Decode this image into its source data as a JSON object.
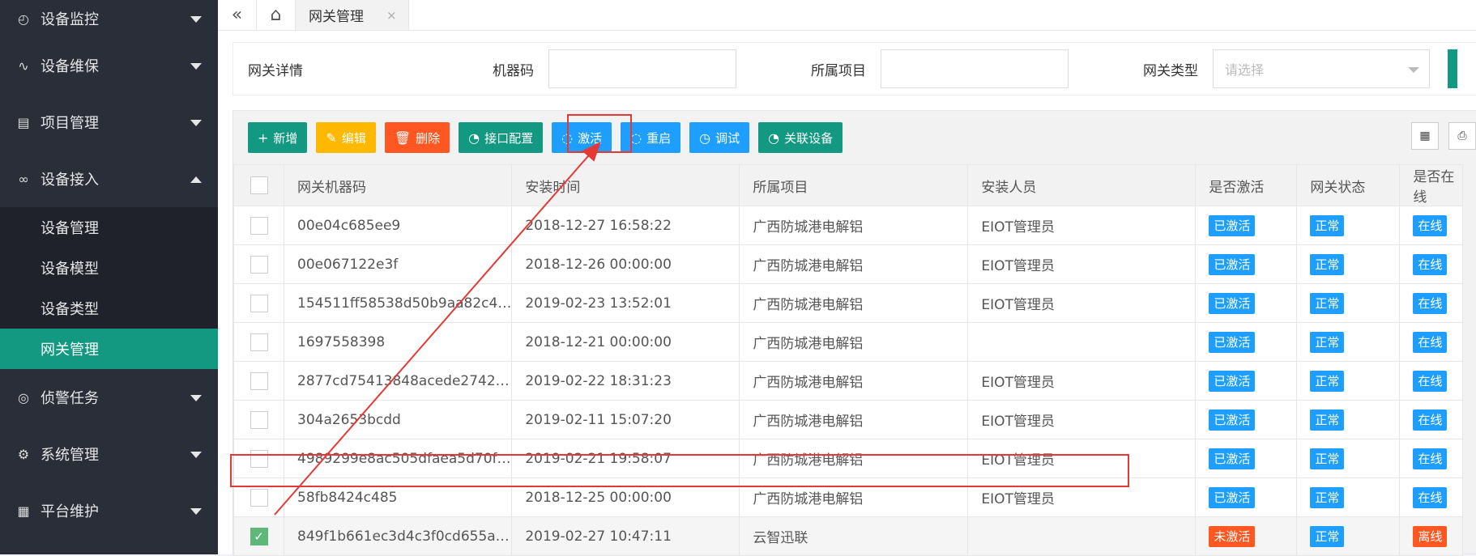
{
  "sidebar": {
    "items": [
      {
        "label": "设备监控",
        "icon": "dashboard-icon"
      },
      {
        "label": "设备维保",
        "icon": "pulse-icon"
      },
      {
        "label": "项目管理",
        "icon": "book-icon"
      },
      {
        "label": "设备接入",
        "icon": "link-icon",
        "expanded": true,
        "children": [
          {
            "label": "设备管理"
          },
          {
            "label": "设备模型"
          },
          {
            "label": "设备类型"
          },
          {
            "label": "网关管理",
            "active": true
          }
        ]
      },
      {
        "label": "侦警任务",
        "icon": "target-icon"
      },
      {
        "label": "系统管理",
        "icon": "gear-icon"
      },
      {
        "label": "平台维护",
        "icon": "grid-icon"
      }
    ]
  },
  "tabs": {
    "collapse_glyph": "«",
    "home_glyph": "⌂",
    "active_tab": "网关管理",
    "close_glyph": "×"
  },
  "filter": {
    "title": "网关详情",
    "machine_code_label": "机器码",
    "machine_code_value": "",
    "project_label": "所属项目",
    "project_value": "",
    "gateway_type_label": "网关类型",
    "gateway_type_placeholder": "请选择"
  },
  "toolbar": {
    "buttons": [
      {
        "label": "新增",
        "glyph": "+"
      },
      {
        "label": "编辑",
        "glyph": "✎"
      },
      {
        "label": "删除",
        "glyph": "🗑"
      },
      {
        "label": "接口配置",
        "glyph": "◔"
      },
      {
        "label": "激活",
        "glyph": "◌"
      },
      {
        "label": "重启",
        "glyph": "◌"
      },
      {
        "label": "调试",
        "glyph": "◷"
      },
      {
        "label": "关联设备",
        "glyph": "◔"
      }
    ],
    "right_icons": [
      "columns-icon",
      "print-icon"
    ]
  },
  "table": {
    "columns": [
      "网关机器码",
      "安装时间",
      "所属项目",
      "安装人员",
      "是否激活",
      "网关状态",
      "是否在线"
    ],
    "rows": [
      {
        "code": "00e04c685ee9",
        "time": "2018-12-27 16:58:22",
        "project": "广西防城港电解铝",
        "installer": "EIOT管理员",
        "active": "已激活",
        "status": "正常",
        "online": "在线",
        "checked": false
      },
      {
        "code": "00e067122e3f",
        "time": "2018-12-26 00:00:00",
        "project": "广西防城港电解铝",
        "installer": "EIOT管理员",
        "active": "已激活",
        "status": "正常",
        "online": "在线",
        "checked": false
      },
      {
        "code": "154511ff58538d50b9aa82c4…",
        "time": "2019-02-23 13:52:01",
        "project": "广西防城港电解铝",
        "installer": "EIOT管理员",
        "active": "已激活",
        "status": "正常",
        "online": "在线",
        "checked": false
      },
      {
        "code": "1697558398",
        "time": "2018-12-21 00:00:00",
        "project": "广西防城港电解铝",
        "installer": "",
        "active": "已激活",
        "status": "正常",
        "online": "在线",
        "checked": false
      },
      {
        "code": "2877cd75413848acede2742…",
        "time": "2019-02-22 18:31:23",
        "project": "广西防城港电解铝",
        "installer": "EIOT管理员",
        "active": "已激活",
        "status": "正常",
        "online": "在线",
        "checked": false
      },
      {
        "code": "304a2653bcdd",
        "time": "2019-02-11 15:07:20",
        "project": "广西防城港电解铝",
        "installer": "EIOT管理员",
        "active": "已激活",
        "status": "正常",
        "online": "在线",
        "checked": false
      },
      {
        "code": "4989299e8ac505dfaea5d70f…",
        "time": "2019-02-21 19:58:07",
        "project": "广西防城港电解铝",
        "installer": "EIOT管理员",
        "active": "已激活",
        "status": "正常",
        "online": "在线",
        "checked": false
      },
      {
        "code": "58fb8424c485",
        "time": "2018-12-25 00:00:00",
        "project": "广西防城港电解铝",
        "installer": "EIOT管理员",
        "active": "已激活",
        "status": "正常",
        "online": "在线",
        "checked": false
      },
      {
        "code": "849f1b661ec3d4c3f0cd655a…",
        "time": "2019-02-27 10:47:11",
        "project": "云智迅联",
        "installer": "",
        "active": "未激活",
        "status": "正常",
        "online": "离线",
        "checked": true
      }
    ]
  },
  "colors": {
    "sidebar_bg": "#2a2e38",
    "accent": "#139982",
    "annotation_red": "#e53935",
    "badge_blue": "#1e9fff",
    "badge_orange": "#ff5722"
  }
}
